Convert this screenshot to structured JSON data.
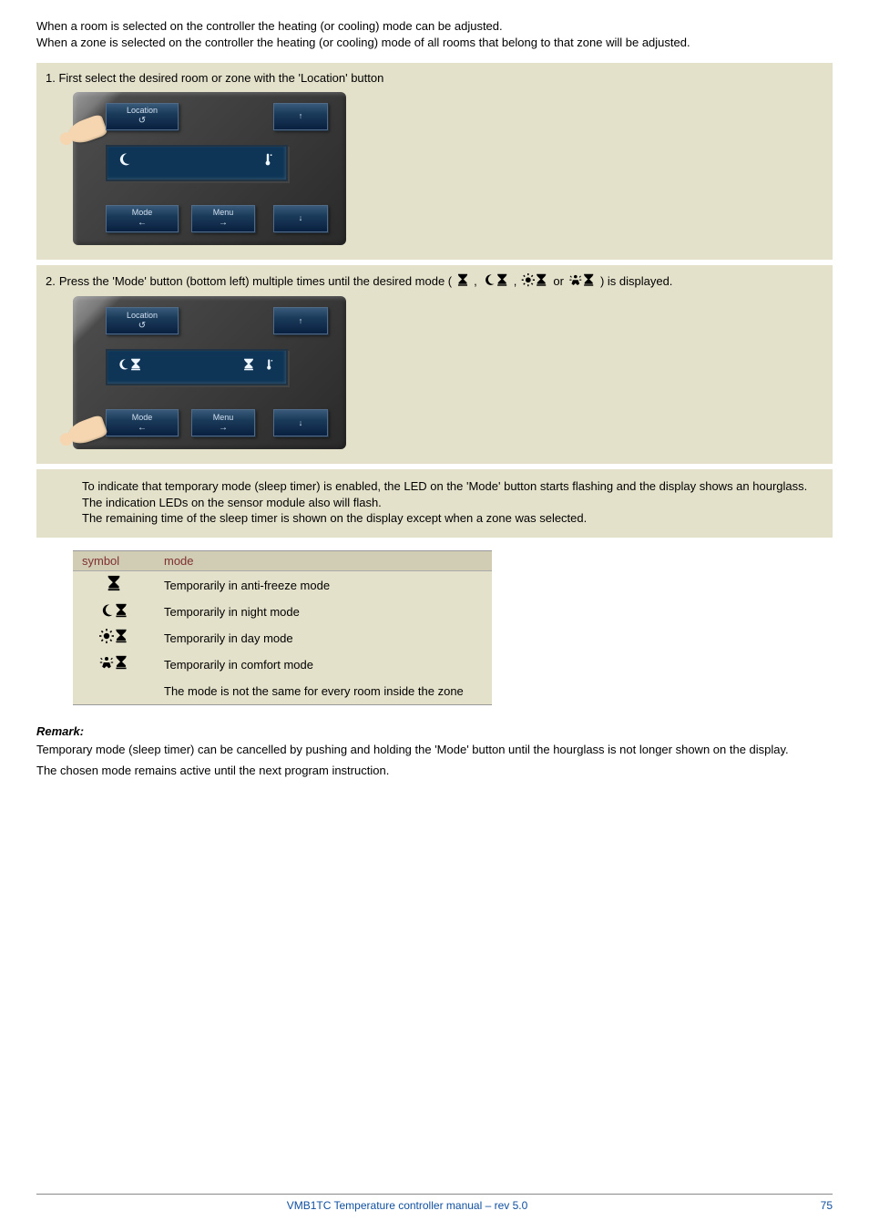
{
  "intro": {
    "p1": "When a room is selected on the controller the heating (or cooling) mode can be adjusted.",
    "p2": "When a zone is selected on the controller the heating (or cooling) mode of all rooms that belong to that zone will be adjusted."
  },
  "step1": {
    "num": "1.",
    "text": "First select the desired room or zone with the 'Location' button"
  },
  "step2": {
    "num": "2.",
    "text_a": "Press the 'Mode' button (bottom left) multiple times until the desired mode (",
    "sep": ",",
    "or": "or",
    "text_b": ") is displayed."
  },
  "controller": {
    "location": "Location",
    "location_sub": "↺",
    "up": "↑",
    "mode": "Mode",
    "mode_sub": "←",
    "menu": "Menu",
    "menu_sub": "→",
    "down": "↓",
    "lcd1_left": "moon-icon",
    "lcd1_right": "temp-icon",
    "lcd2_left": "moon-hourglass-icon",
    "lcd2_mid": "hourglass-icon",
    "lcd2_right": "temp-icon"
  },
  "note": {
    "p1": "To indicate that temporary mode (sleep timer) is enabled, the LED on the 'Mode' button starts flashing and the display shows an hourglass. The indication LEDs on the sensor module also will flash.",
    "p2": "The remaining time of the sleep timer is shown on the display except when a zone was selected."
  },
  "table": {
    "h1": "symbol",
    "h2": "mode",
    "rows": [
      {
        "sym": "hourglass",
        "mode": "Temporarily in anti-freeze mode"
      },
      {
        "sym": "moon-hourglass",
        "mode": "Temporarily in night mode"
      },
      {
        "sym": "sun-hourglass",
        "mode": "Temporarily in day mode"
      },
      {
        "sym": "comfort-hourglass",
        "mode": "Temporarily in comfort mode"
      },
      {
        "sym": "",
        "mode": "The mode is not the same for every room inside the zone"
      }
    ]
  },
  "remark": {
    "title": "Remark:",
    "p1": "Temporary mode (sleep timer) can be cancelled by pushing and holding the 'Mode' button until the hourglass is not longer shown on the display.",
    "p2": "The chosen mode remains active until the next program instruction."
  },
  "footer": {
    "title": "VMB1TC Temperature controller manual – rev 5.0",
    "page": "75"
  },
  "chart_data": {
    "type": "table",
    "title": "Temporary mode symbol legend",
    "columns": [
      "symbol",
      "mode"
    ],
    "rows": [
      [
        "hourglass",
        "Temporarily in anti-freeze mode"
      ],
      [
        "moon + hourglass",
        "Temporarily in night mode"
      ],
      [
        "sun + hourglass",
        "Temporarily in day mode"
      ],
      [
        "person/comfort + hourglass",
        "Temporarily in comfort mode"
      ],
      [
        "(blank)",
        "The mode is not the same for every room inside the zone"
      ]
    ]
  }
}
